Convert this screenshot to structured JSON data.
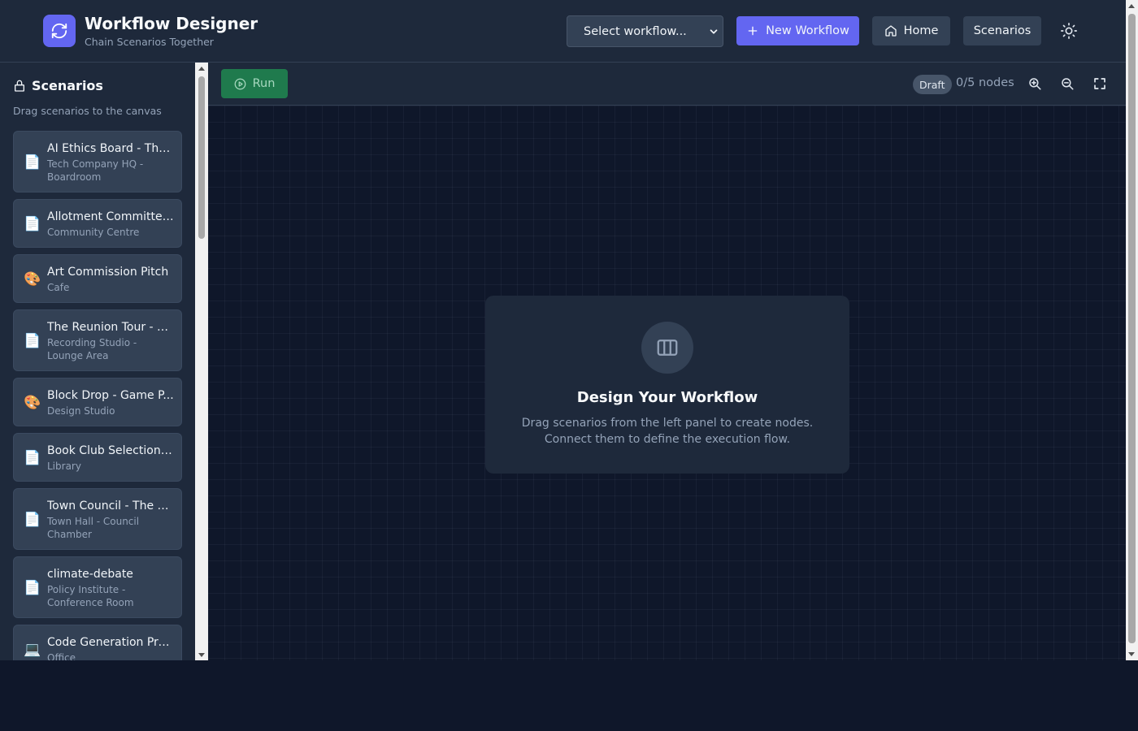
{
  "header": {
    "title": "Workflow Designer",
    "subtitle": "Chain Scenarios Together",
    "workflow_select": "Select workflow...",
    "new_workflow_label": "New Workflow",
    "home_label": "Home",
    "scenarios_label": "Scenarios",
    "logo_icon": "refresh-icon",
    "theme_icon": "sun-icon"
  },
  "sidebar": {
    "title": "Scenarios",
    "hint": "Drag scenarios to the canvas",
    "items": [
      {
        "name": "AI Ethics Board - The ...",
        "location": "Tech Company HQ - Boardroom",
        "icon": "document-icon"
      },
      {
        "name": "Allotment Committee...",
        "location": "Community Centre",
        "icon": "document-icon"
      },
      {
        "name": "Art Commission Pitch",
        "location": "Cafe",
        "icon": "palette-icon"
      },
      {
        "name": "The Reunion Tour - Ol...",
        "location": "Recording Studio - Lounge Area",
        "icon": "document-icon"
      },
      {
        "name": "Block Drop - Game P...",
        "location": "Design Studio",
        "icon": "palette-icon"
      },
      {
        "name": "Book Club Selection S...",
        "location": "Library",
        "icon": "document-icon"
      },
      {
        "name": "Town Council - The Ri...",
        "location": "Town Hall - Council Chamber",
        "icon": "document-icon"
      },
      {
        "name": "climate-debate",
        "location": "Policy Institute - Conference Room",
        "icon": "document-icon"
      },
      {
        "name": "Code Generation Proj...",
        "location": "Office",
        "icon": "laptop-icon"
      }
    ]
  },
  "toolbar": {
    "run_label": "Run",
    "status_badge": "Draft",
    "node_count": "0/5 nodes"
  },
  "canvas": {
    "empty_title": "Design Your Workflow",
    "empty_line1": "Drag scenarios from the left panel to create nodes.",
    "empty_line2": "Connect them to define the execution flow."
  },
  "colors": {
    "accent": "#6366f1",
    "run": "#1f7a4d",
    "surface": "#1e293b",
    "background": "#0f172a"
  }
}
